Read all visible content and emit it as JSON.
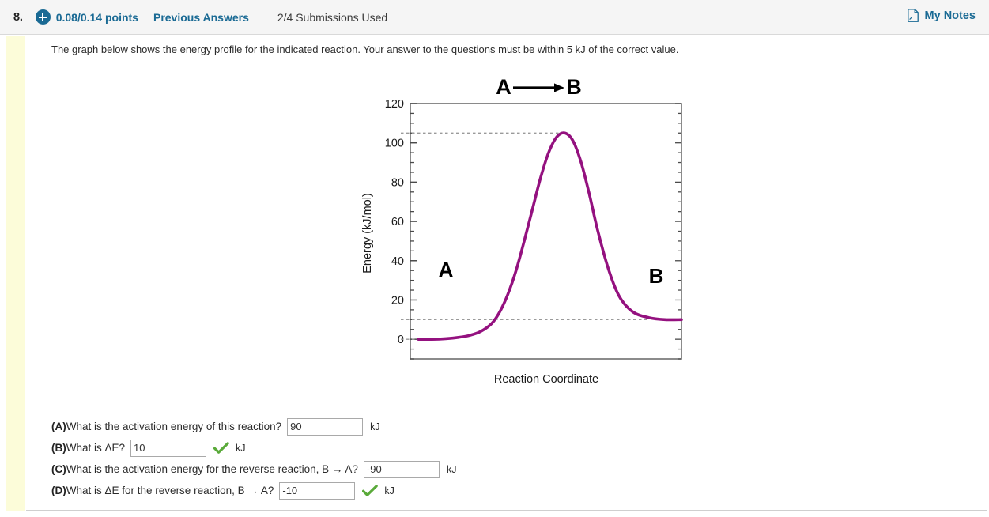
{
  "header": {
    "question_number": "8.",
    "plus_icon": "plus-circle-icon",
    "points": "0.08/0.14 points",
    "previous_answers": "Previous Answers",
    "submissions": "2/4 Submissions Used",
    "notes_icon": "note-page-icon",
    "notes_label": "My Notes",
    "accent_color": "#1a6a94"
  },
  "main": {
    "prompt": "The graph below shows the energy profile for the indicated reaction. Your answer to the questions must be within 5 kJ of the correct value."
  },
  "chart_data": {
    "type": "line",
    "title": "A ⟶ B",
    "title_left": "A",
    "title_right": "B",
    "xlabel": "Reaction Coordinate",
    "ylabel": "Energy (kJ/mol)",
    "ylim": [
      -10,
      120
    ],
    "yticks": [
      0,
      20,
      40,
      60,
      80,
      100,
      120
    ],
    "ytick_labels": [
      "0",
      "20",
      "40",
      "60",
      "80",
      "100",
      "120"
    ],
    "minor_tick_step": 5,
    "xlim": [
      0,
      100
    ],
    "xticks": [],
    "grid": false,
    "legend": "none",
    "curve_color": "#94117f",
    "annotations": [
      {
        "text": "A",
        "x": 10,
        "y": 22,
        "name": "reactant-label"
      },
      {
        "text": "B",
        "x": 90,
        "y": 22,
        "name": "product-label"
      }
    ],
    "guide_lines": [
      {
        "y": 105,
        "label": "transition-state-energy",
        "style": "dashed",
        "color": "#9a9a9a"
      },
      {
        "y": 10,
        "label": "product-energy",
        "style": "dashed",
        "color": "#9a9a9a"
      },
      {
        "y": 0,
        "label": "reactant-energy",
        "style": "dashed",
        "color": "#9a9a9a"
      }
    ],
    "series": [
      {
        "name": "Energy profile",
        "x": [
          3,
          8,
          13,
          18,
          22,
          26,
          30,
          33,
          36,
          39,
          42,
          45,
          48,
          51,
          54,
          57,
          60,
          63,
          66,
          69,
          73,
          77,
          82,
          88,
          94,
          100
        ],
        "y": [
          0,
          0,
          0.3,
          1,
          2,
          4,
          8,
          14,
          23,
          35,
          50,
          66,
          82,
          95,
          103,
          105,
          101,
          90,
          74,
          56,
          36,
          22,
          14,
          11,
          10,
          10
        ]
      }
    ],
    "key_values": {
      "reactant_energy": 0,
      "product_energy": 10,
      "transition_state_energy": 105,
      "forward_activation_energy": 105,
      "delta_e": 10
    }
  },
  "answers": [
    {
      "letter": "(A)",
      "question": "What is the activation energy of this reaction?",
      "value": "90",
      "unit": "kJ",
      "correct": false,
      "input_name": "answer-input-a"
    },
    {
      "letter": "(B)",
      "question": "What is ΔE?",
      "value": "10",
      "unit": "kJ",
      "correct": true,
      "input_name": "answer-input-b"
    },
    {
      "letter": "(C)",
      "question": "What is the activation energy for the reverse reaction, B → A?",
      "value": "-90",
      "unit": "kJ",
      "correct": false,
      "input_name": "answer-input-c"
    },
    {
      "letter": "(D)",
      "question": "What is ΔE for the reverse reaction, B → A?",
      "value": "-10",
      "unit": "kJ",
      "correct": true,
      "input_name": "answer-input-d"
    }
  ],
  "colors": {
    "correct_check": "#5aaa3a",
    "rail": "#fcfcd9",
    "header_bg": "#f5f5f5"
  }
}
